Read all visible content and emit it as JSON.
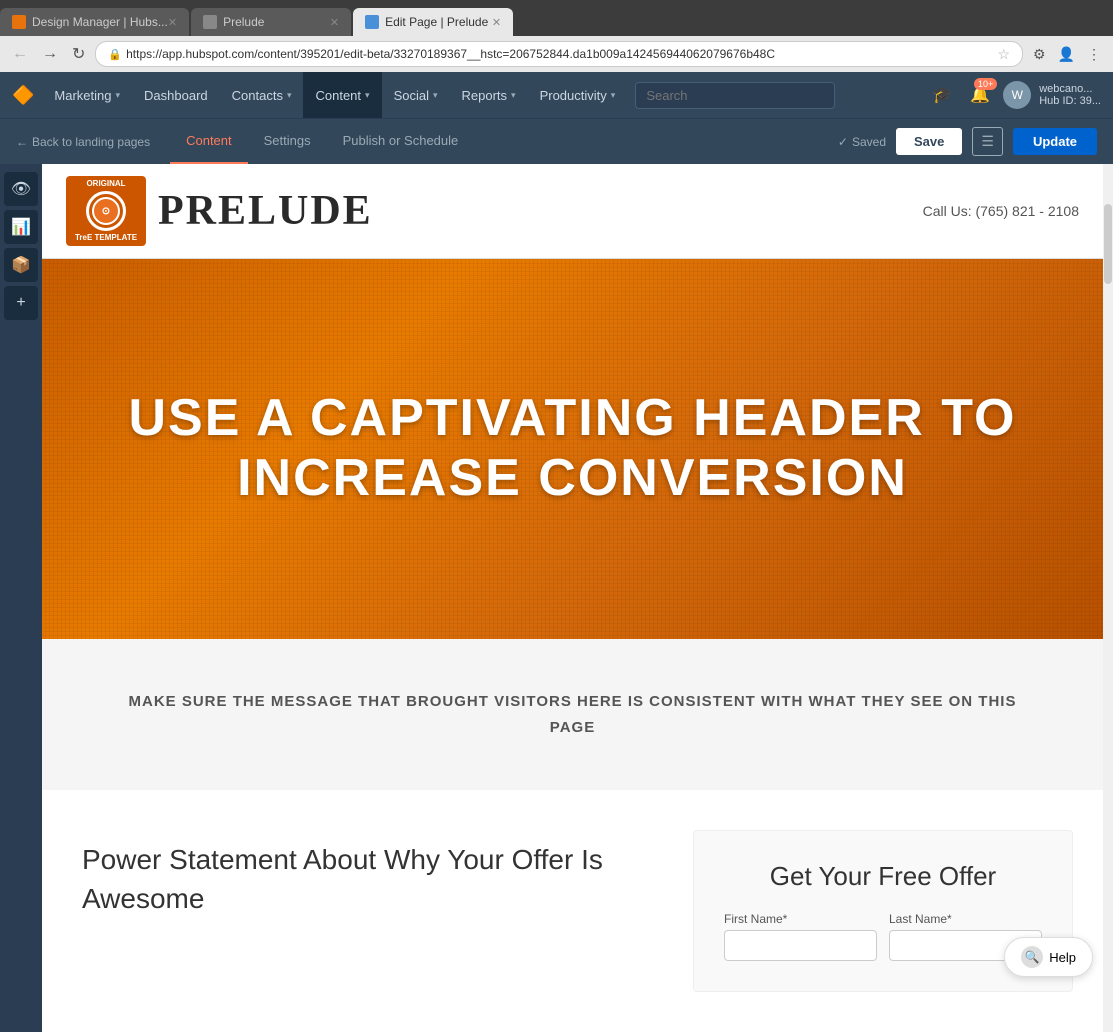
{
  "browser": {
    "tabs": [
      {
        "id": "tab1",
        "label": "Design Manager | Hubs...",
        "active": false,
        "favicon": "orange"
      },
      {
        "id": "tab2",
        "label": "Prelude",
        "active": false,
        "favicon": "grey"
      },
      {
        "id": "tab3",
        "label": "Edit Page | Prelude",
        "active": true,
        "favicon": "blue"
      }
    ],
    "address": "https://app.hubspot.com/content/395201/edit-beta/33270189367__hstc=206752844.da1b009a142456944062079676b48C",
    "secure_label": "Secure"
  },
  "nav": {
    "logo": "🔶",
    "items": [
      {
        "label": "Marketing",
        "has_dropdown": true
      },
      {
        "label": "Dashboard",
        "has_dropdown": false
      },
      {
        "label": "Contacts",
        "has_dropdown": true
      },
      {
        "label": "Content",
        "has_dropdown": true,
        "active": true
      },
      {
        "label": "Social",
        "has_dropdown": true
      },
      {
        "label": "Reports",
        "has_dropdown": true
      },
      {
        "label": "Productivity",
        "has_dropdown": true
      }
    ],
    "search_placeholder": "Search",
    "notification_count": "10+",
    "user_label": "webcano...",
    "hub_id": "Hub ID: 39..."
  },
  "edit_bar": {
    "back_label": "Back to landing pages",
    "tabs": [
      {
        "label": "Content",
        "active": true
      },
      {
        "label": "Settings",
        "active": false
      },
      {
        "label": "Publish or Schedule",
        "active": false
      }
    ],
    "saved_label": "Saved",
    "save_label": "Save",
    "update_label": "Update"
  },
  "sidebar": {
    "buttons": [
      {
        "icon": "👁",
        "label": "Preview"
      },
      {
        "icon": "📊",
        "label": "Analytics"
      },
      {
        "icon": "📦",
        "label": "Modules"
      },
      {
        "icon": "+",
        "label": "Add"
      }
    ]
  },
  "page": {
    "logo_badge_text": "ORIGINAL\nTreE TEMPLATE\nPRELUDE",
    "logo_badge_line1": "ORIGINAL",
    "logo_badge_line2": "TreE TEMPLATE",
    "logo_badge_line3": "PRELUDE",
    "brand_name": "PRELUDE",
    "phone": "Call Us: (765) 821 - 2108",
    "hero_heading_line1": "USE A CAPTIVATING HEADER TO",
    "hero_heading_line2": "INCREASE CONVERSION",
    "sub_hero_text": "MAKE SURE THE MESSAGE THAT BROUGHT VISITORS HERE IS CONSISTENT WITH WHAT\nTHEY SEE ON THIS PAGE",
    "power_statement": "Power Statement About Why Your Offer Is Awesome",
    "form_title": "Get Your Free Offer",
    "form_firstname_label": "First Name*",
    "form_lastname_label": "Last Name*"
  },
  "help": {
    "label": "Help"
  }
}
